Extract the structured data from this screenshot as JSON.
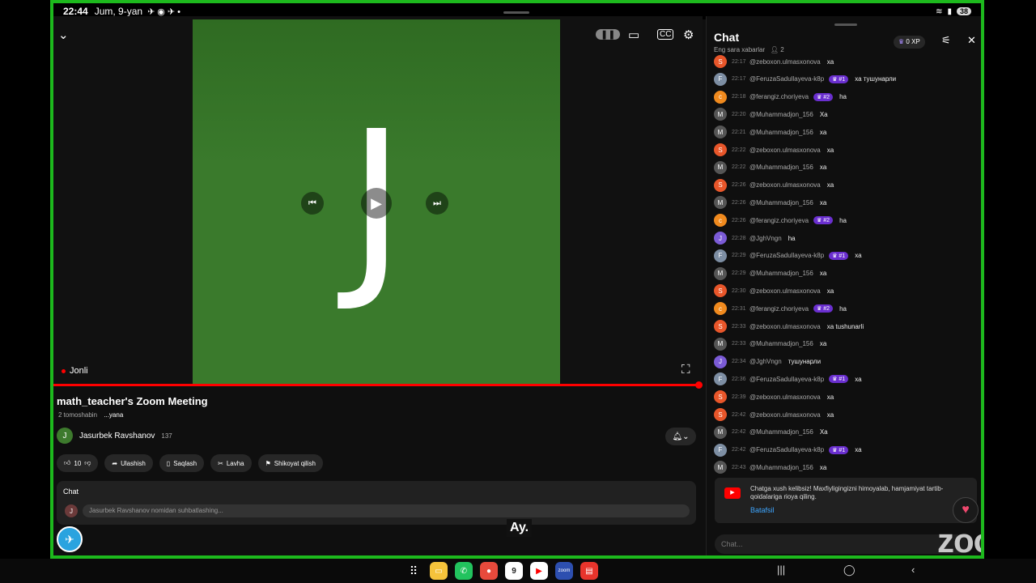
{
  "status": {
    "time": "22:44",
    "date": "Jum, 9-yan",
    "battery": "38"
  },
  "video": {
    "letter": "J",
    "live_label": "Jonli"
  },
  "info": {
    "title": "math_teacher's Zoom Meeting",
    "views": "2 tomoshabin",
    "more": "...yana",
    "channel_initial": "J",
    "channel_name": "Jasurbek Ravshanov",
    "subscribers": "137"
  },
  "actions": {
    "likes": "10",
    "share": "Ulashish",
    "save": "Saqlash",
    "clip": "Lavha",
    "report": "Shikoyat qilish"
  },
  "inline_chat": {
    "label": "Chat",
    "avatar": "J",
    "placeholder": "Jasurbek Ravshanov nomidan suhbatlashing..."
  },
  "caption": "Ay.",
  "chat_panel": {
    "title": "Chat",
    "subtitle": "Eng sara xabarlar",
    "viewers": "2",
    "xp": "0 XP",
    "messages": [
      {
        "avatar": "S",
        "color": "#e8562a",
        "time": "22:17",
        "user": "@zeboxon.ulmasxonova",
        "badge": "",
        "text": "xa"
      },
      {
        "avatar": "F",
        "color": "#7d8ea3",
        "time": "22:17",
        "user": "@FeruzaSadullayeva-k8p",
        "badge": "#1",
        "text": "ха тушунарли"
      },
      {
        "avatar": "c",
        "color": "#f08a1e",
        "time": "22:18",
        "user": "@ferangiz.choriyeva",
        "badge": "#2",
        "text": "ha"
      },
      {
        "avatar": "M",
        "color": "#555555",
        "time": "22:20",
        "user": "@Muhammadjon_156",
        "badge": "",
        "text": "Xa"
      },
      {
        "avatar": "M",
        "color": "#555555",
        "time": "22:21",
        "user": "@Muhammadjon_156",
        "badge": "",
        "text": "xa"
      },
      {
        "avatar": "S",
        "color": "#e8562a",
        "time": "22:22",
        "user": "@zeboxon.ulmasxonova",
        "badge": "",
        "text": "xa"
      },
      {
        "avatar": "M",
        "color": "#555555",
        "time": "22:22",
        "user": "@Muhammadjon_156",
        "badge": "",
        "text": "xa"
      },
      {
        "avatar": "S",
        "color": "#e8562a",
        "time": "22:26",
        "user": "@zeboxon.ulmasxonova",
        "badge": "",
        "text": "xa"
      },
      {
        "avatar": "M",
        "color": "#555555",
        "time": "22:26",
        "user": "@Muhammadjon_156",
        "badge": "",
        "text": "xa"
      },
      {
        "avatar": "c",
        "color": "#f08a1e",
        "time": "22:26",
        "user": "@ferangiz.choriyeva",
        "badge": "#2",
        "text": "ha"
      },
      {
        "avatar": "J",
        "color": "#7b5bd6",
        "time": "22:28",
        "user": "@JghVngn",
        "badge": "",
        "text": "ha"
      },
      {
        "avatar": "F",
        "color": "#7d8ea3",
        "time": "22:29",
        "user": "@FeruzaSadullayeva-k8p",
        "badge": "#1",
        "text": "ха"
      },
      {
        "avatar": "M",
        "color": "#555555",
        "time": "22:29",
        "user": "@Muhammadjon_156",
        "badge": "",
        "text": "xa"
      },
      {
        "avatar": "S",
        "color": "#e8562a",
        "time": "22:30",
        "user": "@zeboxon.ulmasxonova",
        "badge": "",
        "text": "xa"
      },
      {
        "avatar": "c",
        "color": "#f08a1e",
        "time": "22:31",
        "user": "@ferangiz.choriyeva",
        "badge": "#2",
        "text": "ha"
      },
      {
        "avatar": "S",
        "color": "#e8562a",
        "time": "22:33",
        "user": "@zeboxon.ulmasxonova",
        "badge": "",
        "text": "xa tushunarli"
      },
      {
        "avatar": "M",
        "color": "#555555",
        "time": "22:33",
        "user": "@Muhammadjon_156",
        "badge": "",
        "text": "xa"
      },
      {
        "avatar": "J",
        "color": "#7b5bd6",
        "time": "22:34",
        "user": "@JghVngn",
        "badge": "",
        "text": "тушунарли"
      },
      {
        "avatar": "F",
        "color": "#7d8ea3",
        "time": "22:36",
        "user": "@FeruzaSadullayeva-k8p",
        "badge": "#1",
        "text": "ха"
      },
      {
        "avatar": "S",
        "color": "#e8562a",
        "time": "22:39",
        "user": "@zeboxon.ulmasxonova",
        "badge": "",
        "text": "xa"
      },
      {
        "avatar": "S",
        "color": "#e8562a",
        "time": "22:42",
        "user": "@zeboxon.ulmasxonova",
        "badge": "",
        "text": "xa"
      },
      {
        "avatar": "M",
        "color": "#555555",
        "time": "22:42",
        "user": "@Muhammadjon_156",
        "badge": "",
        "text": "Xa"
      },
      {
        "avatar": "F",
        "color": "#7d8ea3",
        "time": "22:42",
        "user": "@FeruzaSadullayeva-k8p",
        "badge": "#1",
        "text": "ха"
      },
      {
        "avatar": "M",
        "color": "#555555",
        "time": "22:43",
        "user": "@Muhammadjon_156",
        "badge": "",
        "text": "xa"
      }
    ],
    "welcome_text": "Chatga xush kelibsiz! Maxfiyligingizni himoyalab, hamjamiyat tartib-qoidalariga rioya qiling.",
    "welcome_link": "Batafsil",
    "input_placeholder": "Chat..."
  },
  "watermark": "zoom",
  "dock": {
    "calendar_day": "9"
  },
  "colors": {
    "frame": "#1db91d",
    "accent_red": "#ff0000",
    "badge": "#6a2fcf",
    "link": "#3ea6ff"
  }
}
